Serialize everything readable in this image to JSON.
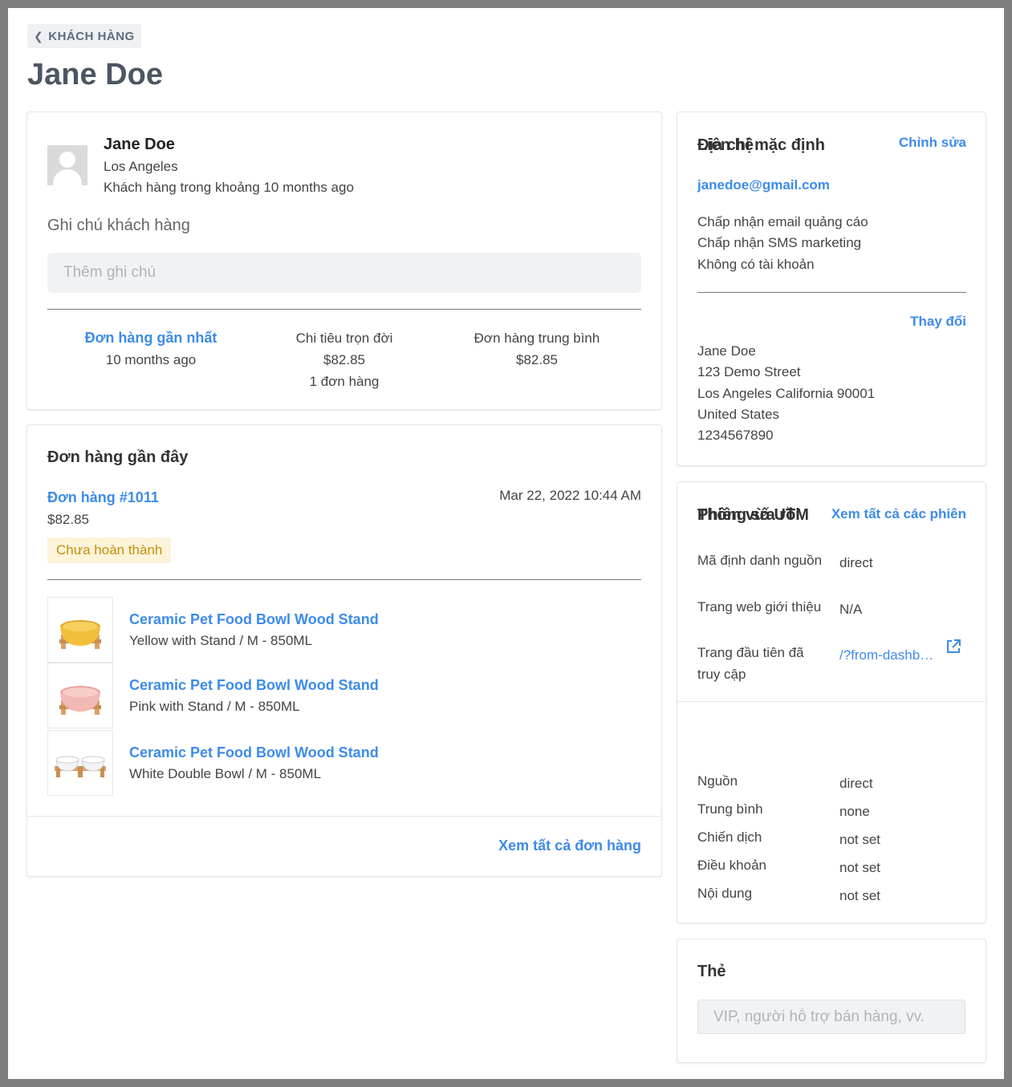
{
  "header": {
    "back_label": "KHÁCH HÀNG",
    "page_title": "Jane Doe"
  },
  "customer": {
    "name": "Jane Doe",
    "city": "Los Angeles",
    "since": "Khách hàng trong khoảng 10 months ago",
    "note_label": "Ghi chú khách hàng",
    "note_placeholder": "Thêm ghi chú",
    "stats": {
      "last_order_label": "Đơn hàng gần nhất",
      "last_order_value": "10 months ago",
      "lifetime_label": "Chi tiêu trọn đời",
      "lifetime_value": "$82.85",
      "lifetime_count": "1 đơn hàng",
      "avg_label": "Đơn hàng trung bình",
      "avg_value": "$82.85"
    }
  },
  "recent_orders": {
    "title": "Đơn hàng gần đây",
    "order_number": "Đơn hàng #1011",
    "order_date": "Mar 22, 2022 10:44 AM",
    "order_total": "$82.85",
    "status": "Chưa hoàn thành",
    "items": [
      {
        "name": "Ceramic Pet Food Bowl Wood Stand",
        "variant": "Yellow with Stand / M - 850ML",
        "color": "#f2bf3a"
      },
      {
        "name": "Ceramic Pet Food Bowl Wood Stand",
        "variant": "Pink with Stand / M - 850ML",
        "color": "#f2b8b3"
      },
      {
        "name": "Ceramic Pet Food Bowl Wood Stand",
        "variant": "White Double Bowl / M - 850ML",
        "color": "#f5f5f5"
      }
    ],
    "view_all": "Xem tất cả đơn hàng"
  },
  "contact": {
    "title": "Liên hệ",
    "edit": "Chỉnh sửa",
    "email": "janedoe@gmail.com",
    "prefs": [
      "Chấp nhận email quảng cáo",
      "Chấp nhận SMS marketing",
      "Không có tài khoản"
    ],
    "address_title": "Địa chỉ mặc định",
    "change": "Thay đổi",
    "address": [
      "Jane Doe",
      "123 Demo Street",
      "Los Angeles California 90001",
      "United States",
      "1234567890"
    ]
  },
  "session": {
    "title": "Phiên vừa rồi",
    "view_all": "Xem tất cả các phiên",
    "source_key": "Mã định danh nguồn",
    "source_val": "direct",
    "referrer_key": "Trang web giới thiệu",
    "referrer_val": "N/A",
    "landing_key": "Trang đầu tiên đã truy cập",
    "landing_val": "/?from-dashboard",
    "utm_title": "Thông số UTM",
    "utm": [
      {
        "key": "Nguồn",
        "val": "direct"
      },
      {
        "key": "Trung bình",
        "val": "none"
      },
      {
        "key": "Chiến dịch",
        "val": "not set"
      },
      {
        "key": "Điều khoản",
        "val": "not set"
      },
      {
        "key": "Nội dung",
        "val": "not set"
      }
    ]
  },
  "tags": {
    "title": "Thẻ",
    "placeholder": "VIP, người hỗ trợ bán hàng, vv."
  },
  "colors": {
    "accent": "#3d8be8",
    "badge_bg": "#fdf3d9",
    "badge_text": "#c4900d"
  }
}
